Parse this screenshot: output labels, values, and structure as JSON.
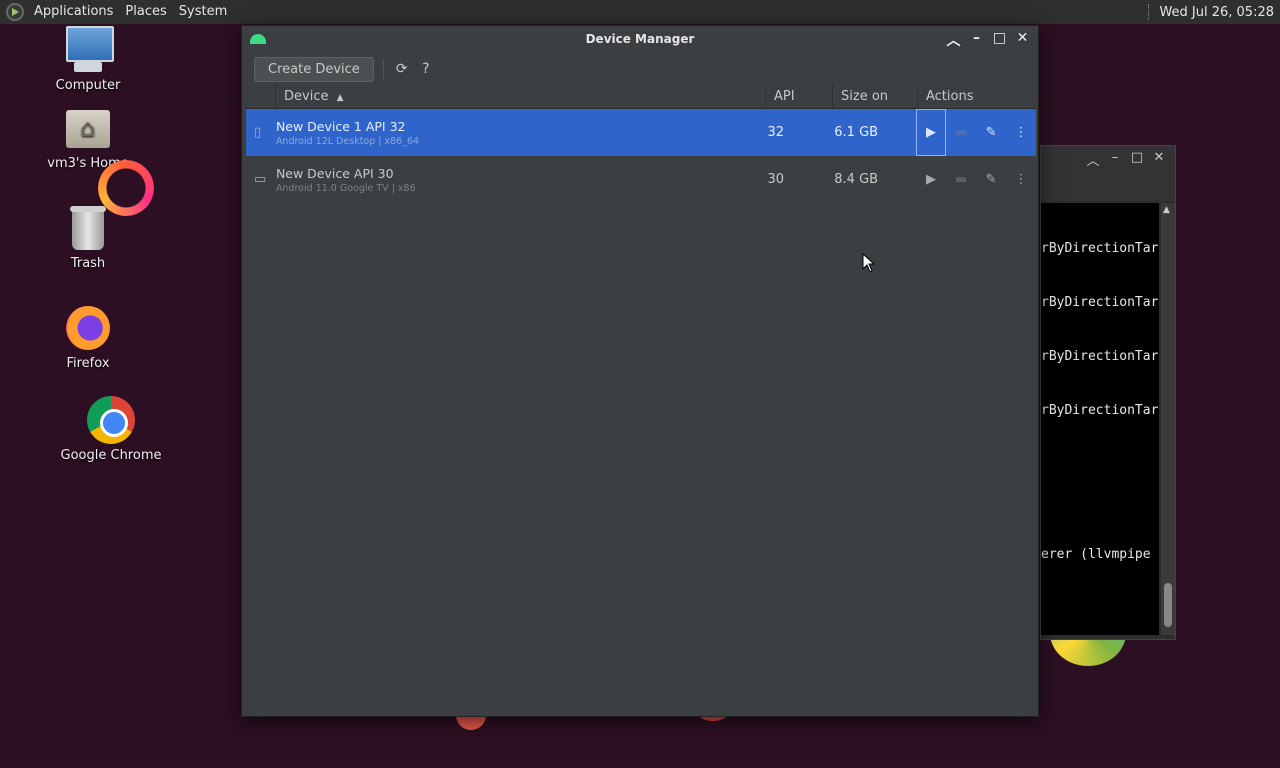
{
  "panel": {
    "menus": [
      "Applications",
      "Places",
      "System"
    ],
    "clock": "Wed Jul 26, 05:28"
  },
  "desktop": {
    "icons": [
      {
        "label": "Computer",
        "icon": "computer-icon"
      },
      {
        "label": "vm3's Home",
        "icon": "home-folder-icon"
      },
      {
        "label": "Trash",
        "icon": "trash-icon"
      },
      {
        "label": "Firefox",
        "icon": "firefox-icon"
      },
      {
        "label": "Google Chrome",
        "icon": "chrome-icon"
      }
    ]
  },
  "terminal": {
    "lines": [
      "rByDirectionTar",
      "rByDirectionTar",
      "rByDirectionTar",
      "rByDirectionTar",
      "erer (llvmpipe"
    ]
  },
  "device_manager": {
    "title": "Device Manager",
    "toolbar": {
      "create_label": "Create Device",
      "refresh_icon": "refresh-icon",
      "help_label": "?"
    },
    "columns": {
      "device": "Device",
      "api": "API",
      "size": "Size on Disk",
      "actions": "Actions"
    },
    "rows": [
      {
        "name": "New Device 1 API 32",
        "sub": "Android 12L Desktop | x86_64",
        "api": "32",
        "size": "6.1 GB",
        "selected": true
      },
      {
        "name": "New Device API 30",
        "sub": "Android 11.0 Google TV | x86",
        "api": "30",
        "size": "8.4 GB",
        "selected": false
      }
    ]
  },
  "colors": {
    "selection": "#2f65ca",
    "window_bg": "#3c3f41",
    "desktop_bg": "#2c0f22",
    "android_green": "#3ddc84"
  }
}
